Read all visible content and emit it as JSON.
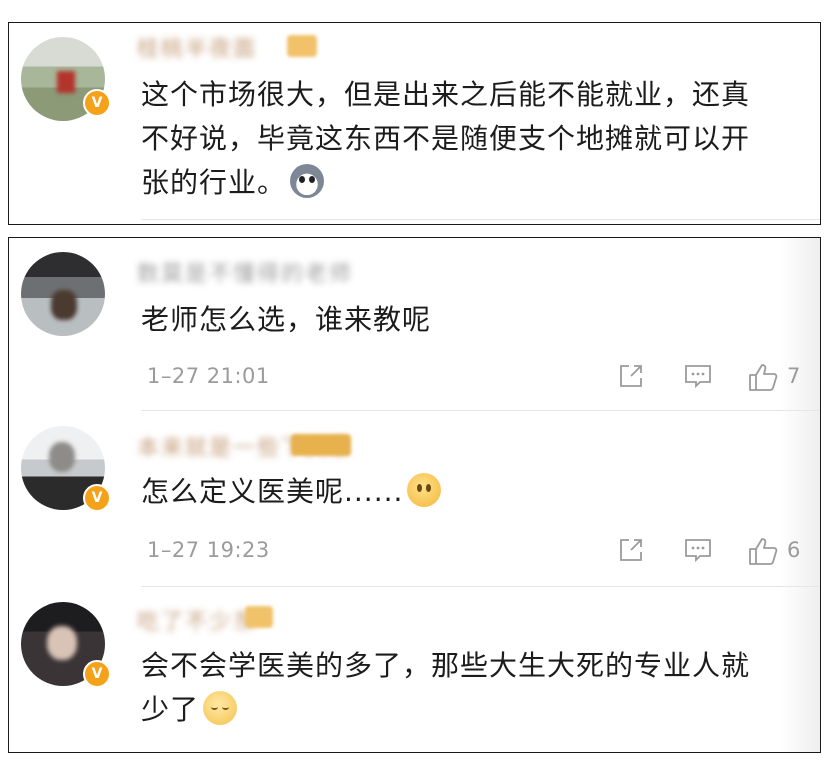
{
  "accent_color": "#f4a21a",
  "badge": {
    "glyph": "V"
  },
  "top_comment": {
    "username": "桂桃半夜面",
    "text_lines": [
      "这个市场很大，但是出来之后能不能就业，还真",
      "不好说，毕竟这东西不是随便支个地摊就可以开",
      "张的行业。"
    ],
    "emoji_icon": "husky-dog-icon"
  },
  "comments": [
    {
      "username": "数莫是不懂得的老师",
      "text_lines": [
        "老师怎么选，谁来教呢"
      ],
      "time": "1–27 21:01",
      "likes": "7",
      "verified": false
    },
    {
      "username": "本来就是一些下兴东",
      "text_lines": [
        "怎么定义医美呢......"
      ],
      "emoji_icon": "thinking-face-icon",
      "time": "1–27 19:23",
      "likes": "6",
      "verified": true
    },
    {
      "username": "吃了不少东",
      "text_lines": [
        "会不会学医美的多了，那些大生大死的专业人就",
        "少了"
      ],
      "emoji_icon": "sad-face-icon",
      "verified": true
    }
  ]
}
